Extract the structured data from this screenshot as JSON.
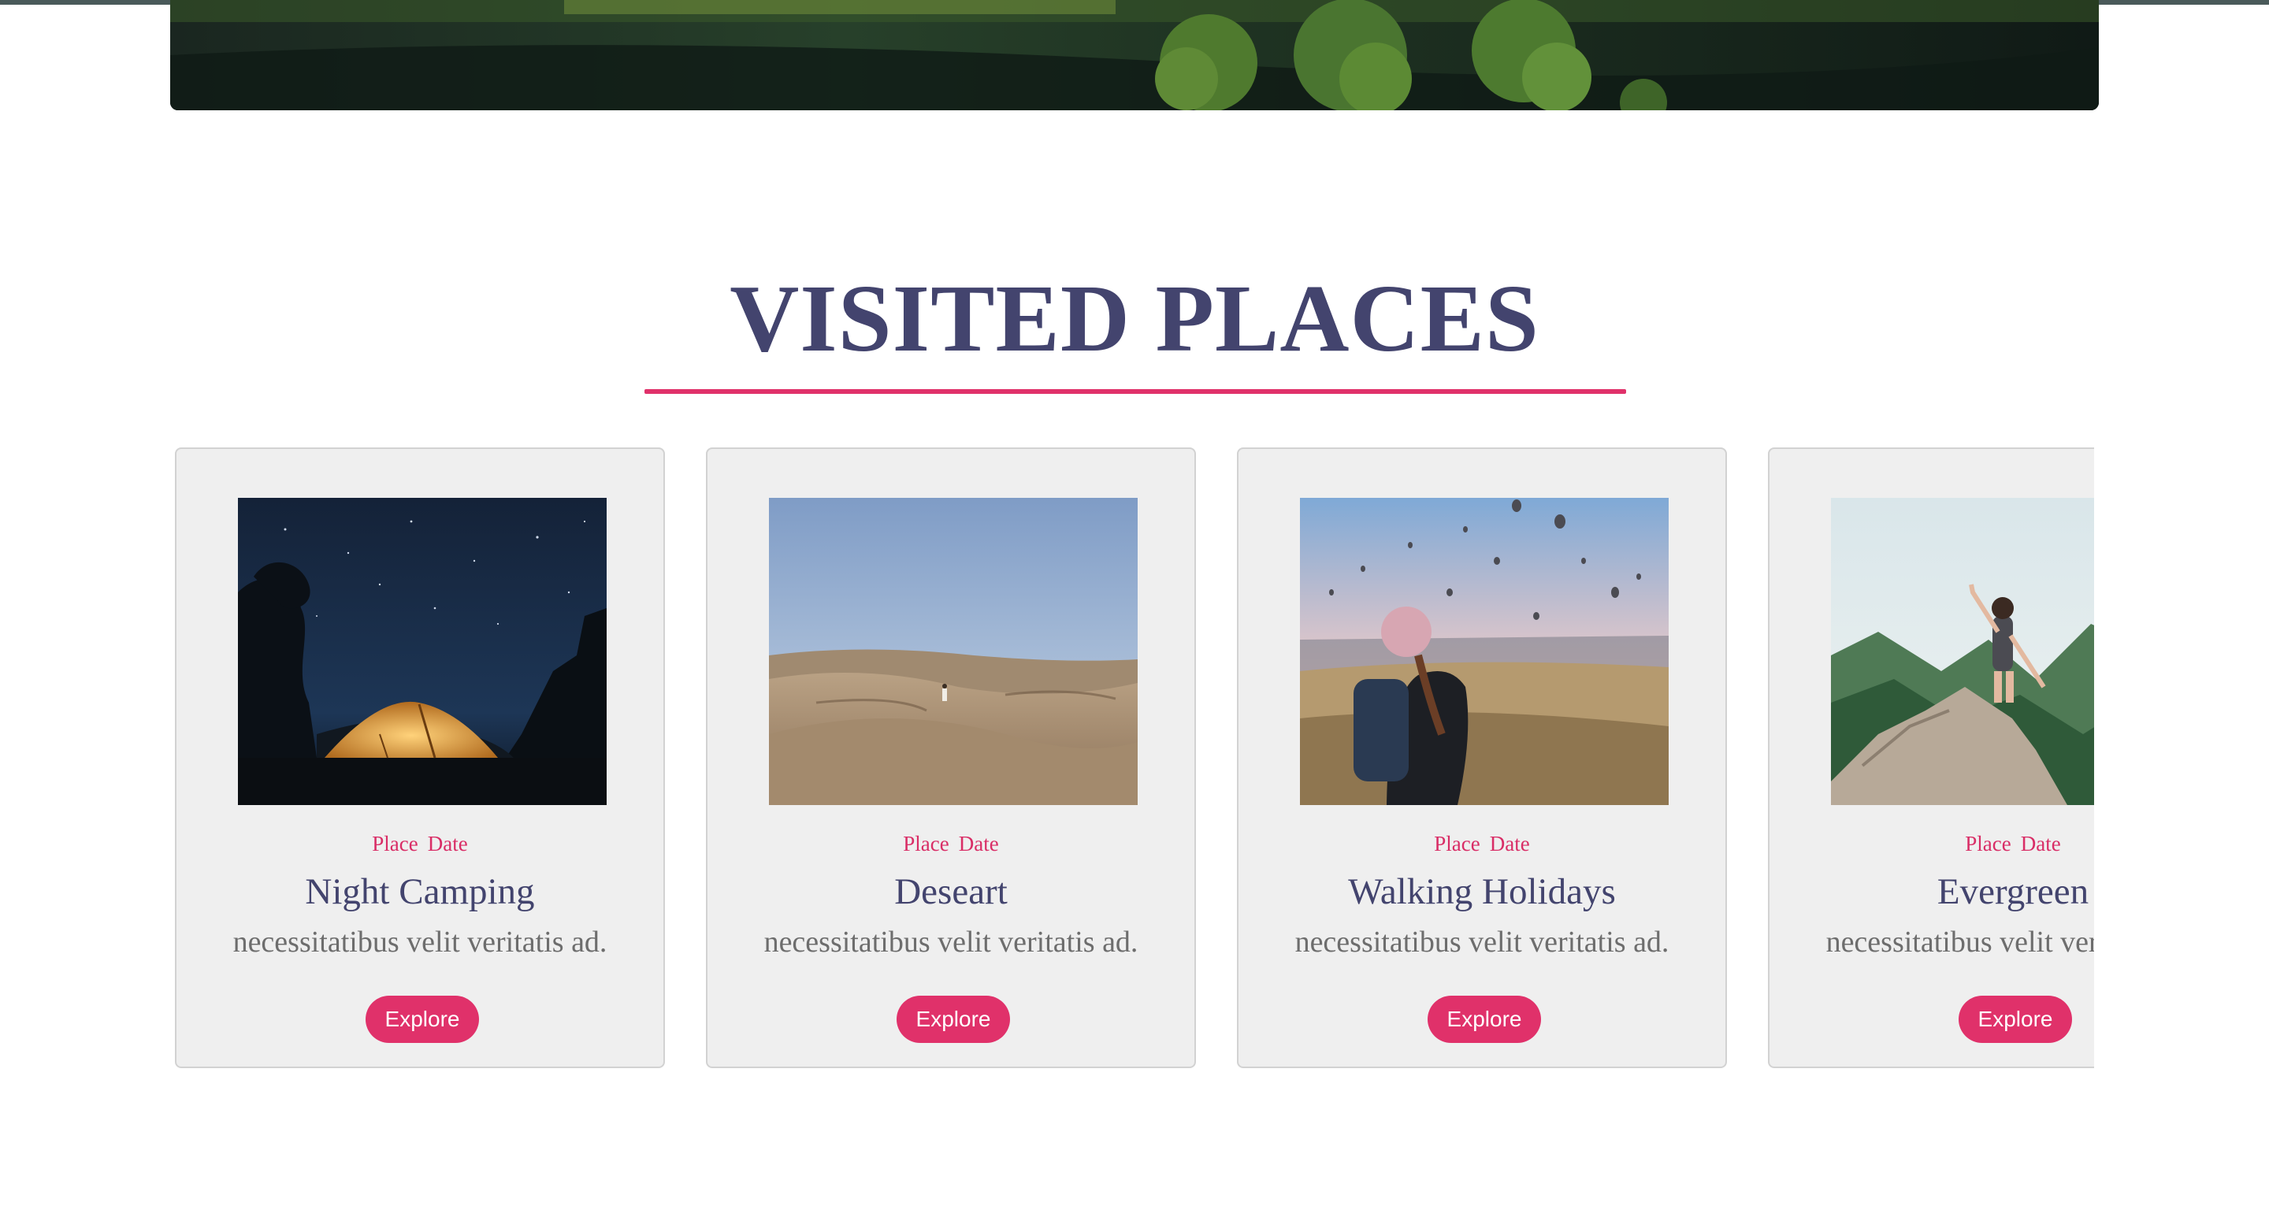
{
  "section": {
    "title": "VISITED PLACES"
  },
  "colors": {
    "accent": "#e0316a",
    "heading": "#43446e",
    "card_background": "#efefef",
    "description": "#6d6d6d"
  },
  "cards": [
    {
      "image": "night-camping-tent-photo",
      "place_label": "Place",
      "date_label": "Date",
      "title": "Night Camping",
      "description": "necessitatibus velit veritatis ad.",
      "button_label": "Explore"
    },
    {
      "image": "desert-dunes-photo",
      "place_label": "Place",
      "date_label": "Date",
      "title": "Deseart",
      "description": "necessitatibus velit veritatis ad.",
      "button_label": "Explore"
    },
    {
      "image": "hot-air-balloons-hiker-photo",
      "place_label": "Place",
      "date_label": "Date",
      "title": "Walking Holidays",
      "description": "necessitatibus velit veritatis ad.",
      "button_label": "Explore"
    },
    {
      "image": "mountain-hiker-photo",
      "place_label": "Place",
      "date_label": "Date",
      "title": "Evergreen",
      "description": "necessitatibus velit veritatis ad.",
      "button_label": "Explore"
    }
  ]
}
